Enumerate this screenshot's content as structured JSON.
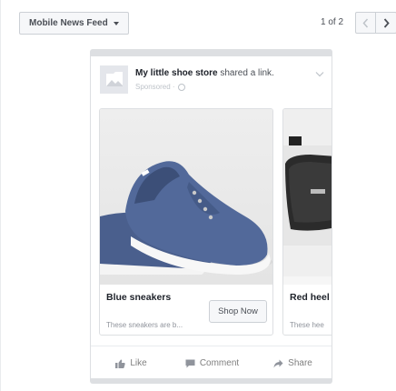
{
  "toolbar": {
    "placement_label": "Mobile News Feed",
    "pager_text": "1 of 2"
  },
  "post": {
    "page_name": "My little shoe store",
    "action_text": " shared a link.",
    "sponsored_text": "Sponsored ·"
  },
  "carousel": {
    "cards": [
      {
        "title": "Blue sneakers",
        "description": "These sneakers are b...",
        "cta": "Shop Now"
      },
      {
        "title": "Red heel",
        "description": "These hee"
      }
    ]
  },
  "actions": {
    "like": "Like",
    "comment": "Comment",
    "share": "Share"
  },
  "colors": {
    "sneaker_blue": "#4a5f8d",
    "border": "#dddfe2",
    "muted_text": "#90949c"
  },
  "icons": [
    "caret-down-icon",
    "chevron-left-icon",
    "chevron-right-icon",
    "page-placeholder-icon",
    "globe-icon",
    "post-options-chevron-icon",
    "like-icon",
    "comment-icon",
    "share-icon"
  ]
}
